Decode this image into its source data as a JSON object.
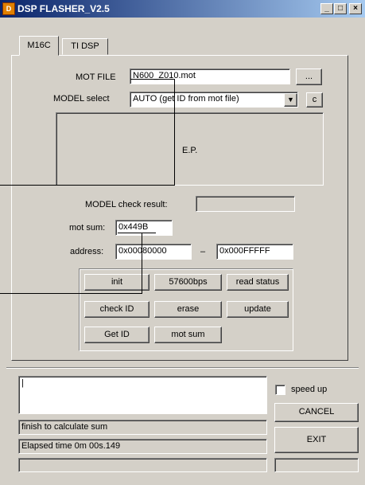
{
  "window": {
    "title": "DSP FLASHER_V2.5",
    "icon_text": "D",
    "minimize": "_",
    "maximize": "□",
    "close": "×"
  },
  "tabs": [
    {
      "label": "M16C",
      "active": true
    },
    {
      "label": "TI DSP",
      "active": false
    }
  ],
  "mot_file": {
    "label": "MOT FILE",
    "value": "N600_Z010.mot",
    "browse_label": "..."
  },
  "model_select": {
    "label": "MODEL select",
    "value": "AUTO (get ID from mot file)",
    "dropdown_arrow": "▼",
    "c_label": "c"
  },
  "ep_box": {
    "label": "E.P."
  },
  "model_check": {
    "label": "MODEL check result:",
    "value": ""
  },
  "mot_sum": {
    "label": "mot sum:",
    "value": "0x449B"
  },
  "address": {
    "label": "address:",
    "start": "0x00080000",
    "dash": "–",
    "end": "0x000FFFFF"
  },
  "buttons": {
    "init": "init",
    "baud": "57600bps",
    "read_status": "read status",
    "check_id": "check ID",
    "erase": "erase",
    "update": "update",
    "get_id": "Get ID",
    "mot_sum": "mot sum"
  },
  "bottom": {
    "log_value": "|",
    "speed_up_label": "speed up",
    "speed_up_checked": false,
    "cancel_label": "CANCEL",
    "exit_label": "EXIT",
    "status_line_1": "finish to calculate sum",
    "status_line_2": "Elapsed time 0m 00s.149",
    "progress_fraction": 0.0
  },
  "colors": {
    "face": "#d4d0c8",
    "title_start": "#0a246a",
    "title_end": "#a6caf0"
  }
}
